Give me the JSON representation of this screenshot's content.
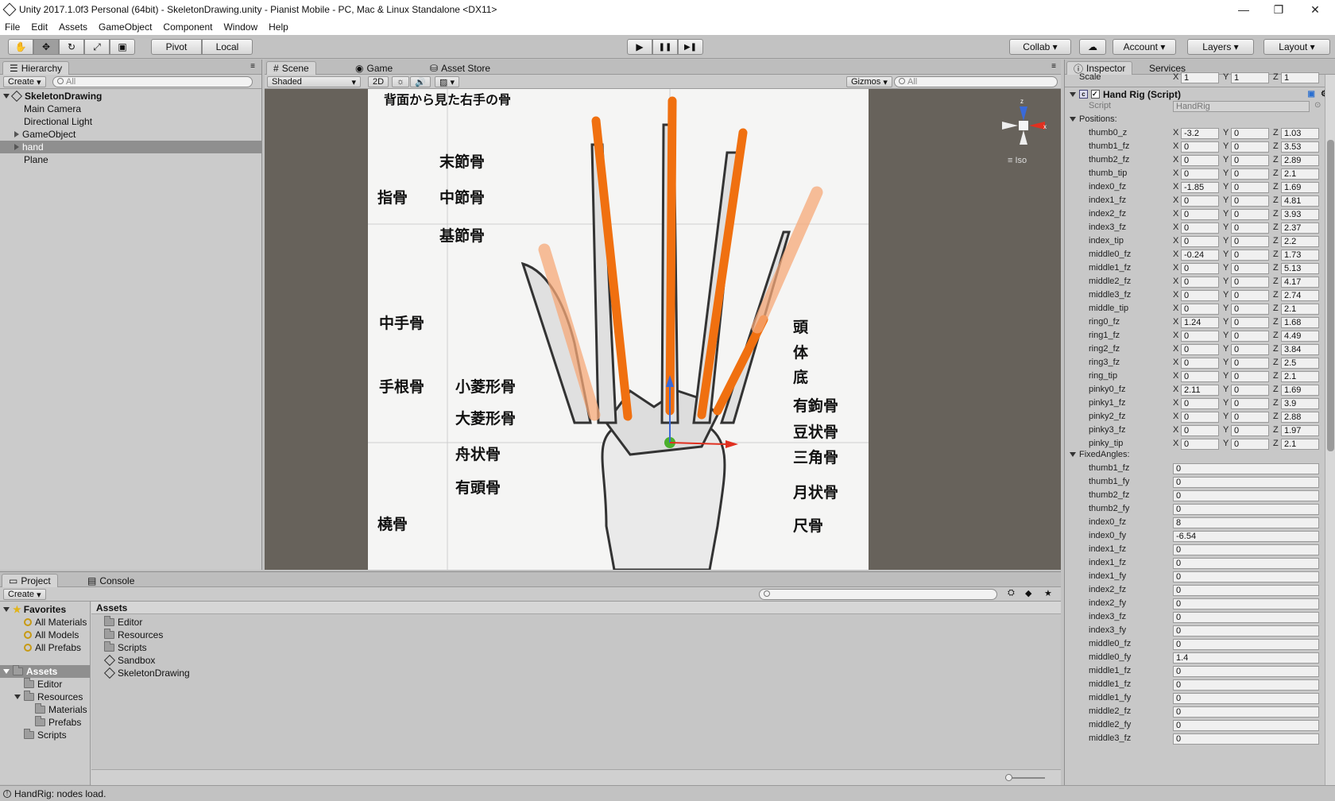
{
  "window": {
    "title": "Unity 2017.1.0f3 Personal (64bit) - SkeletonDrawing.unity - Pianist Mobile - PC, Mac & Linux Standalone <DX11>",
    "minimize": "—",
    "maximize": "❐",
    "close": "✕"
  },
  "menu": [
    "File",
    "Edit",
    "Assets",
    "GameObject",
    "Component",
    "Window",
    "Help"
  ],
  "toolbar": {
    "tools": [
      "hand-icon",
      "move-icon",
      "rotate-icon",
      "scale-icon",
      "rect-icon"
    ],
    "pivot": "Pivot",
    "local": "Local",
    "play": "▶",
    "pause": "❚❚",
    "step": "▶❚",
    "collab": "Collab ▾",
    "account": "Account",
    "layers": "Layers",
    "layout": "Layout"
  },
  "hierarchy": {
    "tab": "Hierarchy",
    "create": "Create",
    "search": "All",
    "scene": "SkeletonDrawing",
    "items": [
      "Main Camera",
      "Directional Light",
      "GameObject",
      "hand",
      "Plane"
    ]
  },
  "scene": {
    "tabs": [
      "Scene",
      "Game",
      "Asset Store"
    ],
    "shading": "Shaded",
    "mode2d": "2D",
    "gizmos": "Gizmos",
    "search": "All",
    "iso": "Iso",
    "image_title": "背面から見た右手の骨",
    "labels_left": [
      "末節骨",
      "中節骨",
      "基節骨",
      "指骨",
      "中手骨",
      "手根骨",
      "小菱形骨",
      "大菱形骨",
      "舟状骨",
      "有頭骨",
      "橈骨"
    ],
    "labels_right": [
      "頭",
      "体",
      "底",
      "有鉤骨",
      "豆状骨",
      "三角骨",
      "月状骨",
      "尺骨"
    ]
  },
  "project": {
    "tabs": [
      "Project",
      "Console"
    ],
    "create": "Create",
    "favorites": "Favorites",
    "fav_items": [
      "All Materials",
      "All Models",
      "All Prefabs"
    ],
    "assets": "Assets",
    "tree": [
      "Editor",
      "Resources",
      "Materials",
      "Prefabs",
      "Scripts"
    ],
    "assets_header": "Assets",
    "contents": [
      "Editor",
      "Resources",
      "Scripts",
      "Sandbox",
      "SkeletonDrawing"
    ]
  },
  "inspector": {
    "tabs": [
      "Inspector",
      "Services"
    ],
    "scale": {
      "label": "Scale",
      "x": "1",
      "y": "1",
      "z": "1"
    },
    "component": "Hand Rig (Script)",
    "script_label": "Script",
    "script_value": "HandRig",
    "positions_label": "Positions:",
    "positions": [
      {
        "n": "thumb0_z",
        "x": "-3.2",
        "y": "0",
        "z": "1.03"
      },
      {
        "n": "thumb1_fz",
        "x": "0",
        "y": "0",
        "z": "3.53"
      },
      {
        "n": "thumb2_fz",
        "x": "0",
        "y": "0",
        "z": "2.89"
      },
      {
        "n": "thumb_tip",
        "x": "0",
        "y": "0",
        "z": "2.1"
      },
      {
        "n": "index0_fz",
        "x": "-1.85",
        "y": "0",
        "z": "1.69"
      },
      {
        "n": "index1_fz",
        "x": "0",
        "y": "0",
        "z": "4.81"
      },
      {
        "n": "index2_fz",
        "x": "0",
        "y": "0",
        "z": "3.93"
      },
      {
        "n": "index3_fz",
        "x": "0",
        "y": "0",
        "z": "2.37"
      },
      {
        "n": "index_tip",
        "x": "0",
        "y": "0",
        "z": "2.2"
      },
      {
        "n": "middle0_fz",
        "x": "-0.24",
        "y": "0",
        "z": "1.73"
      },
      {
        "n": "middle1_fz",
        "x": "0",
        "y": "0",
        "z": "5.13"
      },
      {
        "n": "middle2_fz",
        "x": "0",
        "y": "0",
        "z": "4.17"
      },
      {
        "n": "middle3_fz",
        "x": "0",
        "y": "0",
        "z": "2.74"
      },
      {
        "n": "middle_tip",
        "x": "0",
        "y": "0",
        "z": "2.1"
      },
      {
        "n": "ring0_fz",
        "x": "1.24",
        "y": "0",
        "z": "1.68"
      },
      {
        "n": "ring1_fz",
        "x": "0",
        "y": "0",
        "z": "4.49"
      },
      {
        "n": "ring2_fz",
        "x": "0",
        "y": "0",
        "z": "3.84"
      },
      {
        "n": "ring3_fz",
        "x": "0",
        "y": "0",
        "z": "2.5"
      },
      {
        "n": "ring_tip",
        "x": "0",
        "y": "0",
        "z": "2.1"
      },
      {
        "n": "pinky0_fz",
        "x": "2.11",
        "y": "0",
        "z": "1.69"
      },
      {
        "n": "pinky1_fz",
        "x": "0",
        "y": "0",
        "z": "3.9"
      },
      {
        "n": "pinky2_fz",
        "x": "0",
        "y": "0",
        "z": "2.88"
      },
      {
        "n": "pinky3_fz",
        "x": "0",
        "y": "0",
        "z": "1.97"
      },
      {
        "n": "pinky_tip",
        "x": "0",
        "y": "0",
        "z": "2.1"
      }
    ],
    "fixed_label": "FixedAngles:",
    "fixed": [
      {
        "n": "thumb1_fz",
        "v": "0"
      },
      {
        "n": "thumb1_fy",
        "v": "0"
      },
      {
        "n": "thumb2_fz",
        "v": "0"
      },
      {
        "n": "thumb2_fy",
        "v": "0"
      },
      {
        "n": "index0_fz",
        "v": "8"
      },
      {
        "n": "index0_fy",
        "v": "-6.54"
      },
      {
        "n": "index1_fz",
        "v": "0"
      },
      {
        "n": "index1_fz",
        "v": "0"
      },
      {
        "n": "index1_fy",
        "v": "0"
      },
      {
        "n": "index2_fz",
        "v": "0"
      },
      {
        "n": "index2_fy",
        "v": "0"
      },
      {
        "n": "index3_fz",
        "v": "0"
      },
      {
        "n": "index3_fy",
        "v": "0"
      },
      {
        "n": "middle0_fz",
        "v": "0"
      },
      {
        "n": "middle0_fy",
        "v": "1.4"
      },
      {
        "n": "middle1_fz",
        "v": "0"
      },
      {
        "n": "middle1_fz",
        "v": "0"
      },
      {
        "n": "middle1_fy",
        "v": "0"
      },
      {
        "n": "middle2_fz",
        "v": "0"
      },
      {
        "n": "middle2_fy",
        "v": "0"
      },
      {
        "n": "middle3_fz",
        "v": "0"
      }
    ]
  },
  "status": "HandRig: nodes load.",
  "colors": {
    "accent_orange": "#f07010",
    "selection": "#8f8f8f",
    "scene_bg": "#67625b"
  }
}
